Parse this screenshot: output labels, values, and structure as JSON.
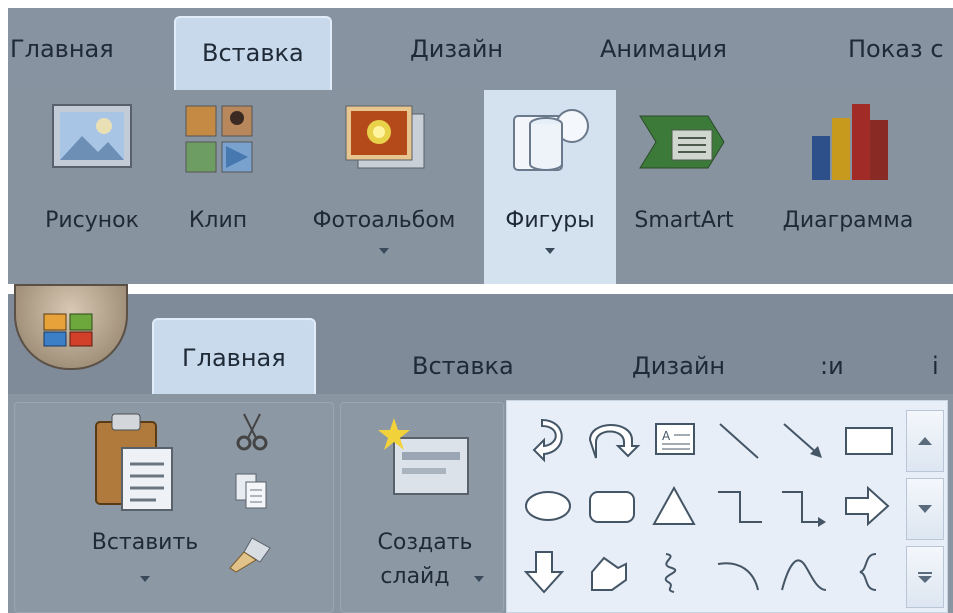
{
  "top": {
    "tabs": [
      {
        "label": "Главная"
      },
      {
        "label": "Вставка",
        "active": true
      },
      {
        "label": "Дизайн"
      },
      {
        "label": "Анимация"
      },
      {
        "label": "Показ с"
      }
    ],
    "buttons": [
      {
        "label": "Рисунок",
        "icon": "picture-icon"
      },
      {
        "label": "Клип",
        "icon": "clip-art-icon"
      },
      {
        "label": "Фотоальбом",
        "icon": "photo-album-icon",
        "dropdown": true
      },
      {
        "label": "Фигуры",
        "icon": "shapes-icon",
        "dropdown": true,
        "highlighted": true
      },
      {
        "label": "SmartArt",
        "icon": "smartart-icon"
      },
      {
        "label": "Диаграмма",
        "icon": "chart-icon"
      }
    ]
  },
  "bottom": {
    "tabs": [
      {
        "label": "Главная",
        "active": true
      },
      {
        "label": "Вставка"
      },
      {
        "label": "Дизайн"
      },
      {
        "label": ":и"
      },
      {
        "label": "i"
      }
    ],
    "paste_label": "Вставить",
    "new_slide_label": [
      "Создать",
      "слайд"
    ],
    "shapes": [
      "curved-right-arrow",
      "u-turn-arrow",
      "text-box",
      "line",
      "arrow-line",
      "rectangle",
      "oval",
      "rounded-rectangle",
      "triangle",
      "elbow-connector",
      "elbow-arrow-connector",
      "right-arrow",
      "down-arrow",
      "freeform-shape",
      "scribble",
      "arc",
      "curve",
      "left-brace"
    ]
  },
  "colors": {
    "ribbon": "#8893a0",
    "active_tab": "#c8d9ec",
    "gallery": "#e7eef7",
    "highlight": "#d4e2f0"
  }
}
